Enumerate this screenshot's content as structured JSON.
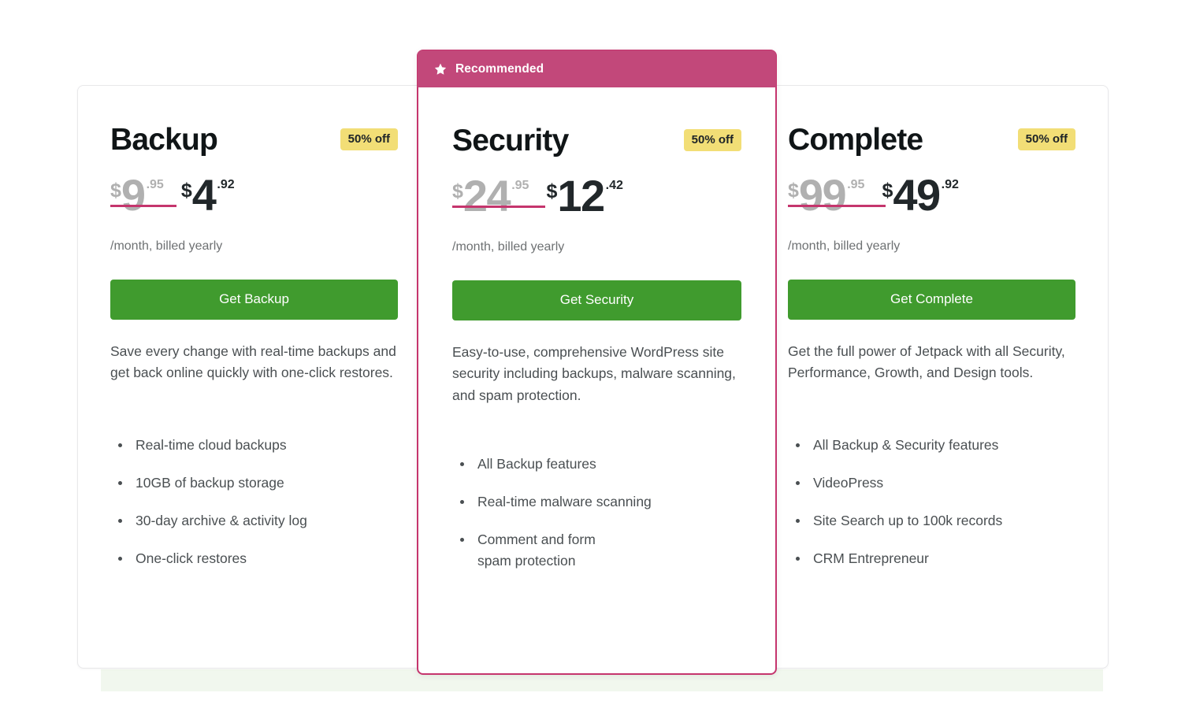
{
  "colors": {
    "accent_green": "#409b2e",
    "accent_crimson": "#c5356d",
    "badge_yellow": "#f2de76",
    "banner_crimson": "#c2487a",
    "text_dark": "#101517",
    "text_muted": "#4a4f52",
    "old_price_gray": "#b0b0b0",
    "band_green": "#f1f7ee"
  },
  "plans": [
    {
      "id": "backup",
      "name": "Backup",
      "discount_badge": "50% off",
      "recommended": false,
      "price_old": {
        "currency": "$",
        "amount": "9",
        "cents": ".95"
      },
      "price_new": {
        "currency": "$",
        "amount": "4",
        "cents": ".92"
      },
      "billing_note": "/month, billed yearly",
      "cta_label": "Get Backup",
      "description": "Save every change with real-time backups and get back online quickly with one-click restores.",
      "features": [
        "Real-time cloud backups",
        "10GB of backup storage",
        "30-day archive & activity log",
        "One-click restores"
      ]
    },
    {
      "id": "security",
      "name": "Security",
      "discount_badge": "50% off",
      "recommended": true,
      "recommended_label": "Recommended",
      "recommended_icon": "star-icon",
      "price_old": {
        "currency": "$",
        "amount": "24",
        "cents": ".95"
      },
      "price_new": {
        "currency": "$",
        "amount": "12",
        "cents": ".42"
      },
      "billing_note": "/month, billed yearly",
      "cta_label": "Get Security",
      "description": "Easy-to-use, comprehensive WordPress site security including backups, malware scanning, and spam protection.",
      "features": [
        "All Backup features",
        "Real-time malware scanning",
        "Comment and form spam protection"
      ]
    },
    {
      "id": "complete",
      "name": "Complete",
      "discount_badge": "50% off",
      "recommended": false,
      "price_old": {
        "currency": "$",
        "amount": "99",
        "cents": ".95"
      },
      "price_new": {
        "currency": "$",
        "amount": "49",
        "cents": ".92"
      },
      "billing_note": "/month, billed yearly",
      "cta_label": "Get Complete",
      "description": "Get the full power of Jetpack with all Security, Performance, Growth, and Design tools.",
      "features": [
        "All Backup & Security features",
        "VideoPress",
        "Site Search up to 100k records",
        "CRM Entrepreneur"
      ]
    }
  ]
}
